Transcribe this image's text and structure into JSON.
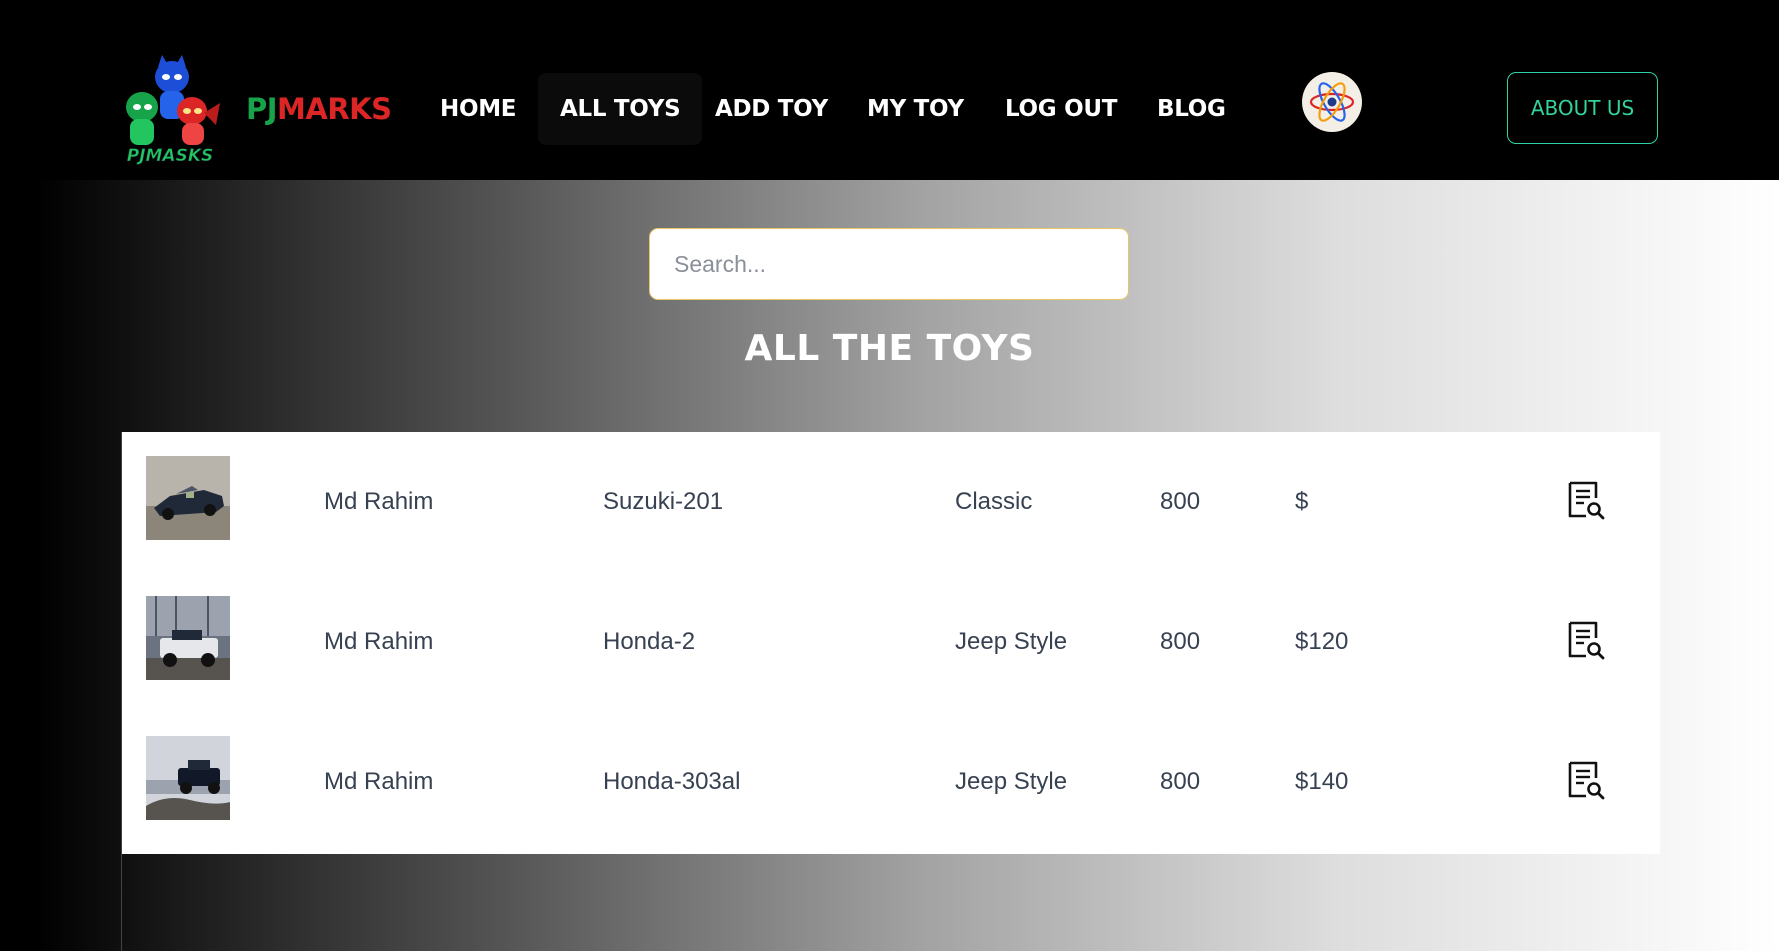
{
  "brand": {
    "pj": "PJ",
    "marks": "MARKS",
    "logo_text": "PJMASKS"
  },
  "nav": {
    "home": "HOME",
    "all_toys": "ALL TOYS",
    "add_toy": "ADD TOY",
    "my_toy": "MY TOY",
    "log_out": "LOG OUT",
    "blog": "BLOG"
  },
  "about_label": "ABOUT US",
  "search": {
    "placeholder": "Search...",
    "value": ""
  },
  "page_title": "ALL THE TOYS",
  "toys": [
    {
      "seller": "Md Rahim",
      "name": "Suzuki-201",
      "category": "Classic",
      "quantity": "800",
      "price": "$",
      "image_icon": "convertible-car-photo"
    },
    {
      "seller": "Md Rahim",
      "name": "Honda-2",
      "category": "Jeep Style",
      "quantity": "800",
      "price": "$120",
      "image_icon": "jeep-toy-photo"
    },
    {
      "seller": "Md Rahim",
      "name": "Honda-303al",
      "category": "Jeep Style",
      "quantity": "800",
      "price": "$140",
      "image_icon": "jeep-toy-photo"
    }
  ],
  "colors": {
    "brand_green": "#16a34a",
    "brand_red": "#dc2626",
    "about_border": "#2dd4a7",
    "search_border": "#e7c66a"
  }
}
